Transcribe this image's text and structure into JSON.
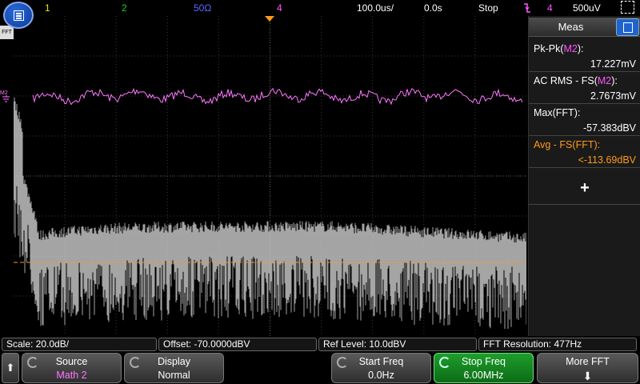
{
  "top_bar": {
    "channels": [
      {
        "label": "1",
        "color": "#e8e800"
      },
      {
        "label": "2",
        "color": "#22cc22"
      },
      {
        "label": "50Ω",
        "color": "#5a6cff"
      },
      {
        "label": "4",
        "color": "#ff55ff"
      }
    ],
    "timebase": "100.0us/",
    "delay": "0.0s",
    "run_state": "Stop",
    "trigger_icon": "trigger-falling-edge-icon",
    "trigger_source": "4",
    "trigger_level": "500uV"
  },
  "graticule": {
    "fft_marker": "FFT",
    "channel_marker": "M2"
  },
  "meas_panel": {
    "title": "Meas",
    "measurements": [
      {
        "label_prefix": "Pk-Pk(",
        "label_source": "M2",
        "label_suffix": "):",
        "value": "17.227mV",
        "color": "#ffffff",
        "source_color": "#ff55ff"
      },
      {
        "label_prefix": "AC RMS - FS(",
        "label_source": "M2",
        "label_suffix": "):",
        "value": "2.7673mV",
        "color": "#ffffff",
        "source_color": "#ff55ff"
      },
      {
        "label_prefix": "Max(",
        "label_source": "FFT",
        "label_suffix": "):",
        "value": "-57.383dBV",
        "color": "#ffffff",
        "source_color": "#ffffff"
      },
      {
        "label_prefix": "Avg - FS(",
        "label_source": "FFT",
        "label_suffix": "):",
        "value": "<-113.69dBV",
        "color": "#ff9a1a",
        "source_color": "#ff9a1a"
      }
    ],
    "add_symbol": "+"
  },
  "status": {
    "scale": "Scale: 20.0dB/",
    "offset": "Offset: -70.0000dBV",
    "ref_level": "Ref Level: 10.0dBV",
    "fft_resolution": "FFT Resolution: 477Hz"
  },
  "softkeys": {
    "back_symbol": "⬆",
    "source": {
      "title": "Source",
      "value": "Math 2"
    },
    "display": {
      "title": "Display",
      "value": "Normal"
    },
    "start_freq": {
      "title": "Start Freq",
      "value": "0.0Hz"
    },
    "stop_freq": {
      "title": "Stop Freq",
      "value": "6.00MHz"
    },
    "more_fft": {
      "title": "More FFT",
      "value": "⬇"
    }
  },
  "colors": {
    "math_trace": "#ff77ff",
    "fft_trace": "#cfcfcf",
    "avg_line": "#ff9a1a",
    "grid": "#3a3a3a"
  }
}
